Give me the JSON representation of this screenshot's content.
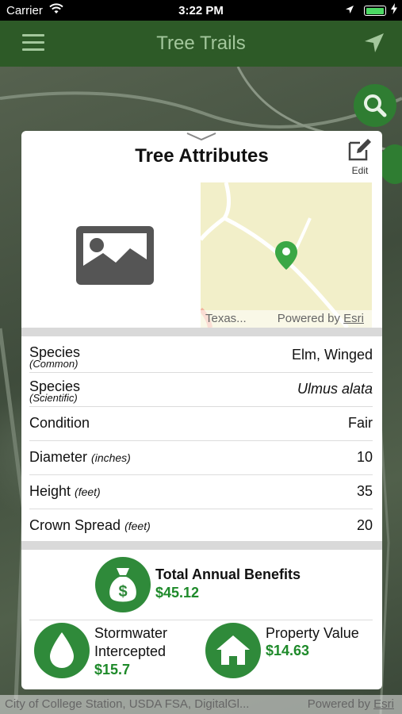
{
  "status_bar": {
    "carrier": "Carrier",
    "time": "3:22 PM"
  },
  "navbar": {
    "title": "Tree Trails"
  },
  "map": {
    "credit_left": "City of College Station, USDA FSA, DigitalGl...",
    "credit_powered": "Powered by ",
    "credit_esri": "Esri"
  },
  "card": {
    "title": "Tree Attributes",
    "edit_label": "Edit",
    "mini_map": {
      "credit_left": "Texas...",
      "credit_powered": "Powered by ",
      "credit_esri": "Esri"
    },
    "attributes": [
      {
        "label": "Species",
        "sub": "(Common)",
        "value": "Elm, Winged"
      },
      {
        "label": "Species",
        "sub": "(Scientific)",
        "value": "Ulmus alata"
      },
      {
        "label": "Condition",
        "value": "Fair"
      },
      {
        "label": "Diameter",
        "unit": "(inches)",
        "value": "10"
      },
      {
        "label": "Height",
        "unit": "(feet)",
        "value": "35"
      },
      {
        "label": "Crown Spread",
        "unit": "(feet)",
        "value": "20"
      }
    ],
    "benefits": {
      "total": {
        "label": "Total Annual Benefits",
        "value": "$45.12"
      },
      "stormwater": {
        "label_line1": "Stormwater",
        "label_line2": "Intercepted",
        "value": "$15.7"
      },
      "property": {
        "label": "Property Value",
        "value": "$14.63"
      }
    }
  },
  "colors": {
    "nav_bg": "#2d5a27",
    "nav_text": "#a3c79c",
    "accent_green": "#2f8a3a",
    "value_green": "#1e8a2a"
  }
}
